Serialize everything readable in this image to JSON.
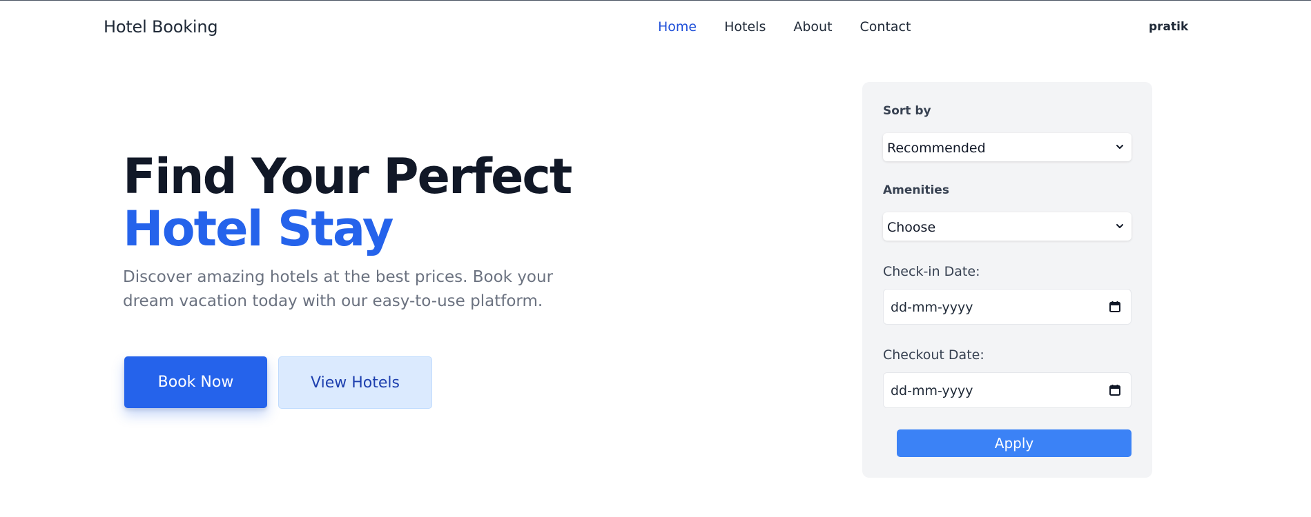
{
  "nav": {
    "brand": "Hotel Booking",
    "links": [
      {
        "label": "Home",
        "active": true
      },
      {
        "label": "Hotels",
        "active": false
      },
      {
        "label": "About",
        "active": false
      },
      {
        "label": "Contact",
        "active": false
      }
    ],
    "user": "pratik"
  },
  "hero": {
    "title_line1": "Find Your Perfect",
    "title_line2": "Hotel Stay",
    "subtitle": "Discover amazing hotels at the best prices. Book your dream vacation today with our easy-to-use platform.",
    "primary_button": "Book Now",
    "secondary_button": "View Hotels"
  },
  "filters": {
    "sort_label": "Sort by",
    "sort_value": "Recommended",
    "amenities_label": "Amenities",
    "amenities_value": "Choose",
    "checkin_label": "Check-in Date:",
    "checkin_placeholder": "dd-mm-yyyy",
    "checkout_label": "Checkout Date:",
    "checkout_placeholder": "dd-mm-yyyy",
    "apply_label": "Apply"
  },
  "colors": {
    "accent": "#2563eb",
    "nav_active": "#1d4ed8",
    "apply_button": "#3b82f6",
    "secondary_button_bg": "#dbeafe",
    "panel_bg": "#f3f4f6"
  },
  "icons": {
    "select_chevron": "chevron-down-icon",
    "date_picker": "calendar-icon"
  }
}
